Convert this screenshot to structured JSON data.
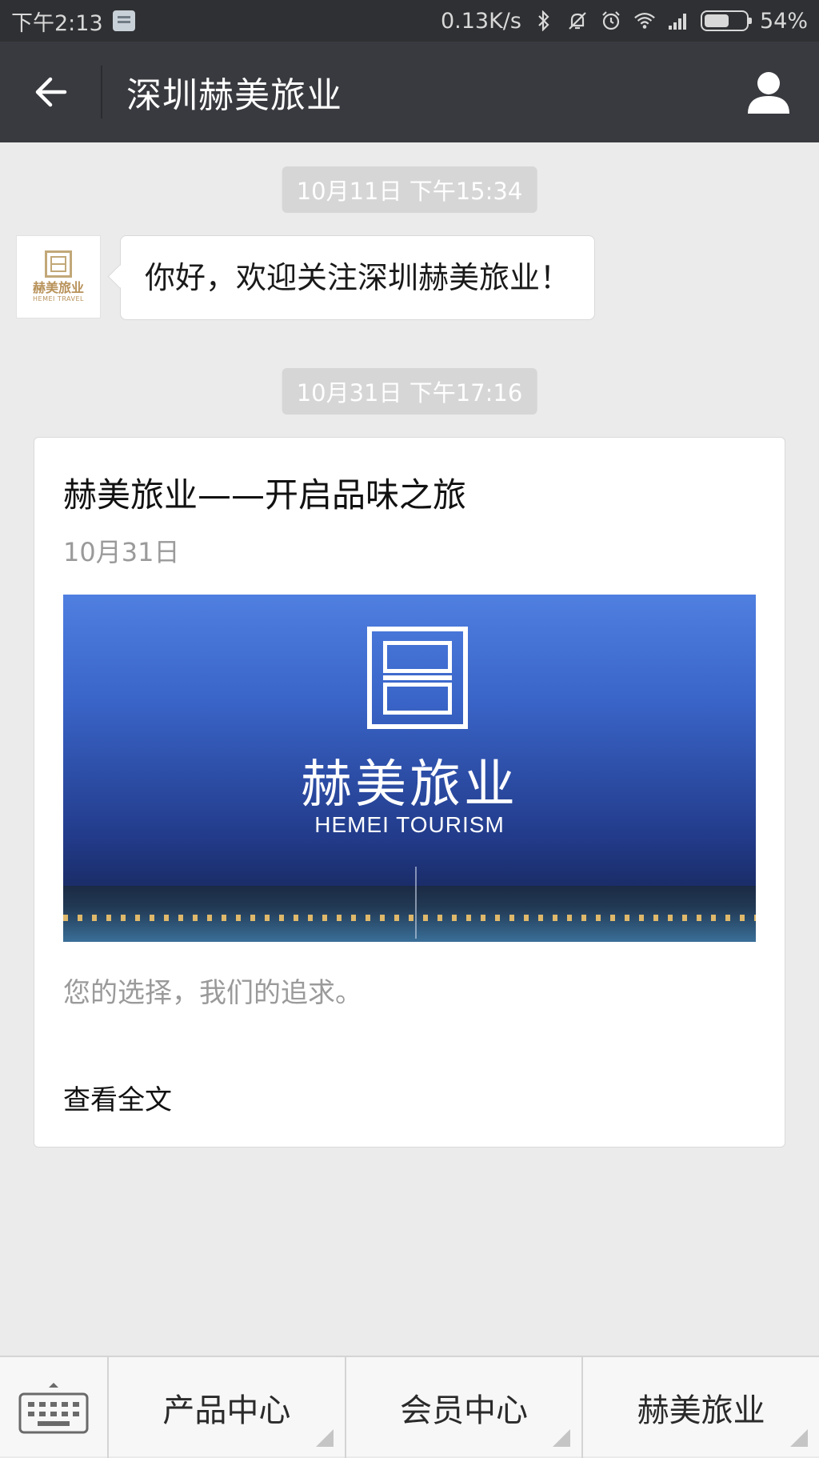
{
  "status_bar": {
    "time": "下午2:13",
    "net_speed": "0.13K/s",
    "battery": "54%"
  },
  "header": {
    "title": "深圳赫美旅业"
  },
  "chat": {
    "timestamp1": "10月11日 下午15:34",
    "welcome_message": "你好，欢迎关注深圳赫美旅业！",
    "avatar_cn": "赫美旅业",
    "avatar_en": "HEMEI TRAVEL",
    "timestamp2": "10月31日 下午17:16"
  },
  "article": {
    "title": "赫美旅业——开启品味之旅",
    "date": "10月31日",
    "cover_brand_cn": "赫美旅业",
    "cover_brand_en": "HEMEI TOURISM",
    "digest": "您的选择，我们的追求。",
    "read_more": "查看全文"
  },
  "menu": {
    "items": [
      {
        "label": "产品中心"
      },
      {
        "label": "会员中心"
      },
      {
        "label": "赫美旅业"
      }
    ]
  },
  "colors": {
    "status_bar": "#2f3033",
    "header": "#393a3f",
    "background": "#ebebeb",
    "timestamp_bg": "#d6d6d6"
  }
}
